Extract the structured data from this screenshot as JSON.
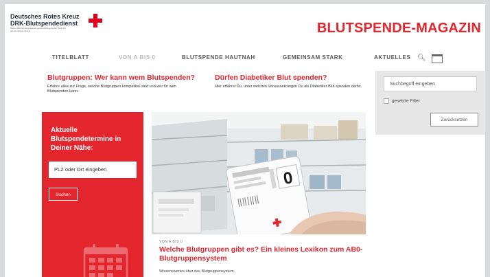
{
  "logo": {
    "line1": "Deutsches Rotes Kreuz",
    "line2": "DRK-Blutspendedienst",
    "tagline": "Baden-Württemberg/Hessen gemeinnützige GmbH Nord-Ost gemeinnützige GmbH"
  },
  "header": {
    "magazine_title": "BLUTSPENDE-MAGAZIN"
  },
  "nav": [
    {
      "label": "TITELBLATT"
    },
    {
      "label": "VON A BIS 0"
    },
    {
      "label": "BLUTSPENDE HAUTNAH"
    },
    {
      "label": "GEMEINSAM STARK"
    },
    {
      "label": "AKTUELLES"
    }
  ],
  "articles": [
    {
      "title": "Blutgruppen: Wer kann wem Blutspenden?",
      "teaser": "Erfahre alles zur Frage, welche Blutgruppen kompatibel sind und wer für wen Blutspenden kann."
    },
    {
      "title": "Dürfen Diabetiker Blut spenden?",
      "teaser": "Hier erfährst Du, unter welchen Voraussetzungen Du als Diabetiker Blut spenden darfst."
    }
  ],
  "sidebar": {
    "search_placeholder": "Suchbegriff eingeben",
    "filter_label": "gesetzte Filter",
    "reset_label": "Zurücksetzen"
  },
  "finder": {
    "title": "Aktuelle Blutspendetermine in Deiner Nähe:",
    "input_placeholder": "PLZ oder Ort eingeben",
    "button_label": "Suchen"
  },
  "feature": {
    "kicker": "VON A BIS 0",
    "title": "Welche Blutgruppen gibt es? Ein kleines Lexikon zum AB0-Blutgruppensystem",
    "subtitle": "Wissenswertes über das Blutgruppensystem.",
    "bag_label": "0",
    "bag_brand": "Deutsches Rotes Kreuz"
  },
  "colors": {
    "brand_red": "#e3252d",
    "logo_navy": "#1e2d3e"
  }
}
